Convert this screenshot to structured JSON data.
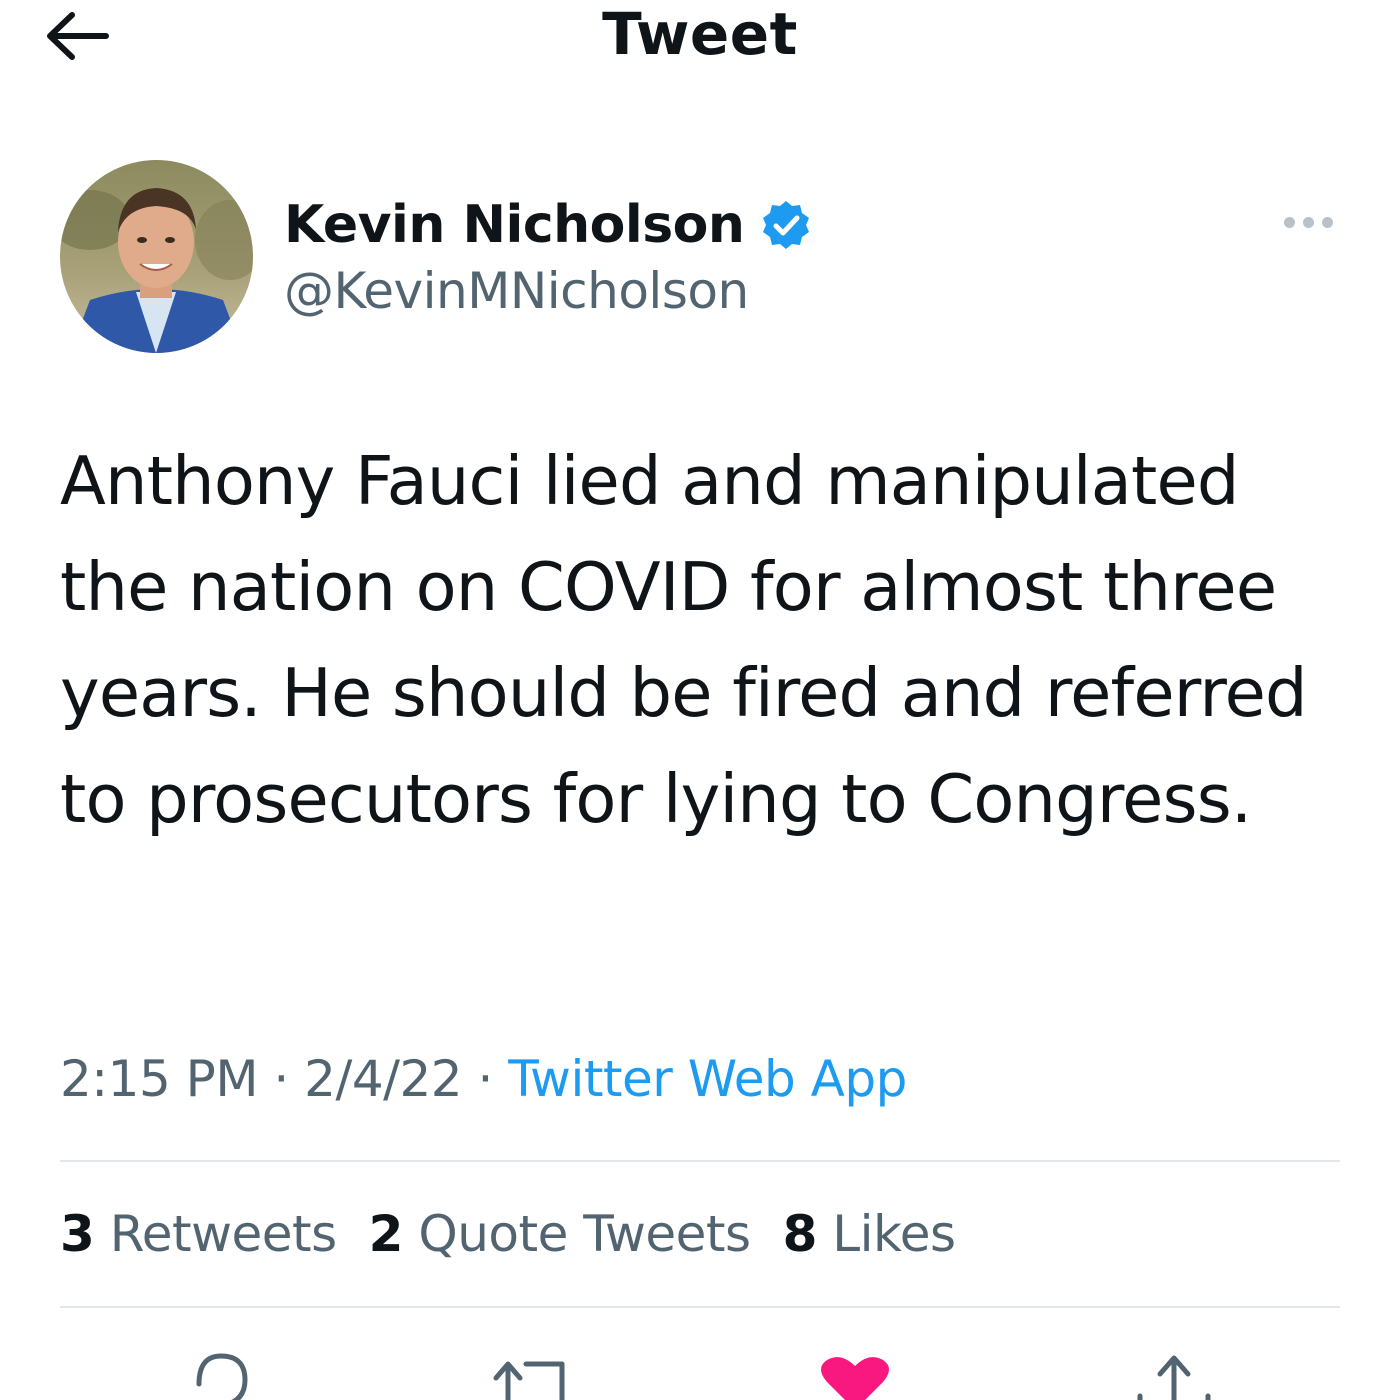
{
  "header": {
    "title": "Tweet",
    "back_icon": "arrow-left-icon"
  },
  "author": {
    "name": "Kevin Nicholson",
    "handle": "@KevinMNicholson",
    "verified": true,
    "verified_icon": "verified-badge-icon",
    "more_icon": "more-horizontal-icon"
  },
  "tweet": {
    "text": "Anthony Fauci lied and manipulated the nation on COVID for almost three years. He should be fired and referred to prosecutors for lying to Congress."
  },
  "meta": {
    "time": "2:15 PM",
    "separator": " · ",
    "date": "2/4/22",
    "source": "Twitter Web App"
  },
  "stats": {
    "retweets": {
      "count": "3",
      "label": "Retweets"
    },
    "quote_tweets": {
      "count": "2",
      "label": "Quote Tweets"
    },
    "likes": {
      "count": "8",
      "label": "Likes"
    }
  },
  "actions": {
    "reply_icon": "reply-icon",
    "retweet_icon": "retweet-icon",
    "like_icon": "heart-filled-icon",
    "share_icon": "share-icon"
  },
  "colors": {
    "accent": "#1d9bf0",
    "text": "#0f1419",
    "secondary": "#536471",
    "like": "#f91880",
    "divider": "#e3e7ea"
  }
}
